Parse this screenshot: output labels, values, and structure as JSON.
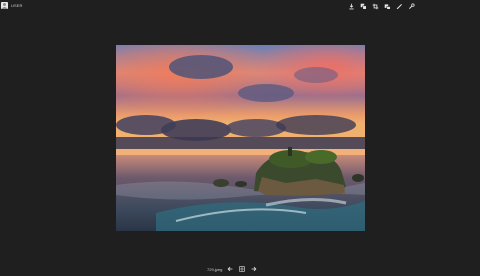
{
  "header": {
    "username": "USER"
  },
  "toolbar": {
    "icons": [
      "download-icon",
      "share-icon",
      "crop-icon",
      "rotate-icon",
      "edit-icon",
      "settings-icon"
    ]
  },
  "footer": {
    "filename": "729.jpeg",
    "icons": [
      "prev-arrow-icon",
      "grid-icon",
      "next-arrow-icon"
    ]
  },
  "colors": {
    "background": "#1f1f1f",
    "icon": "#e6e6e6"
  }
}
